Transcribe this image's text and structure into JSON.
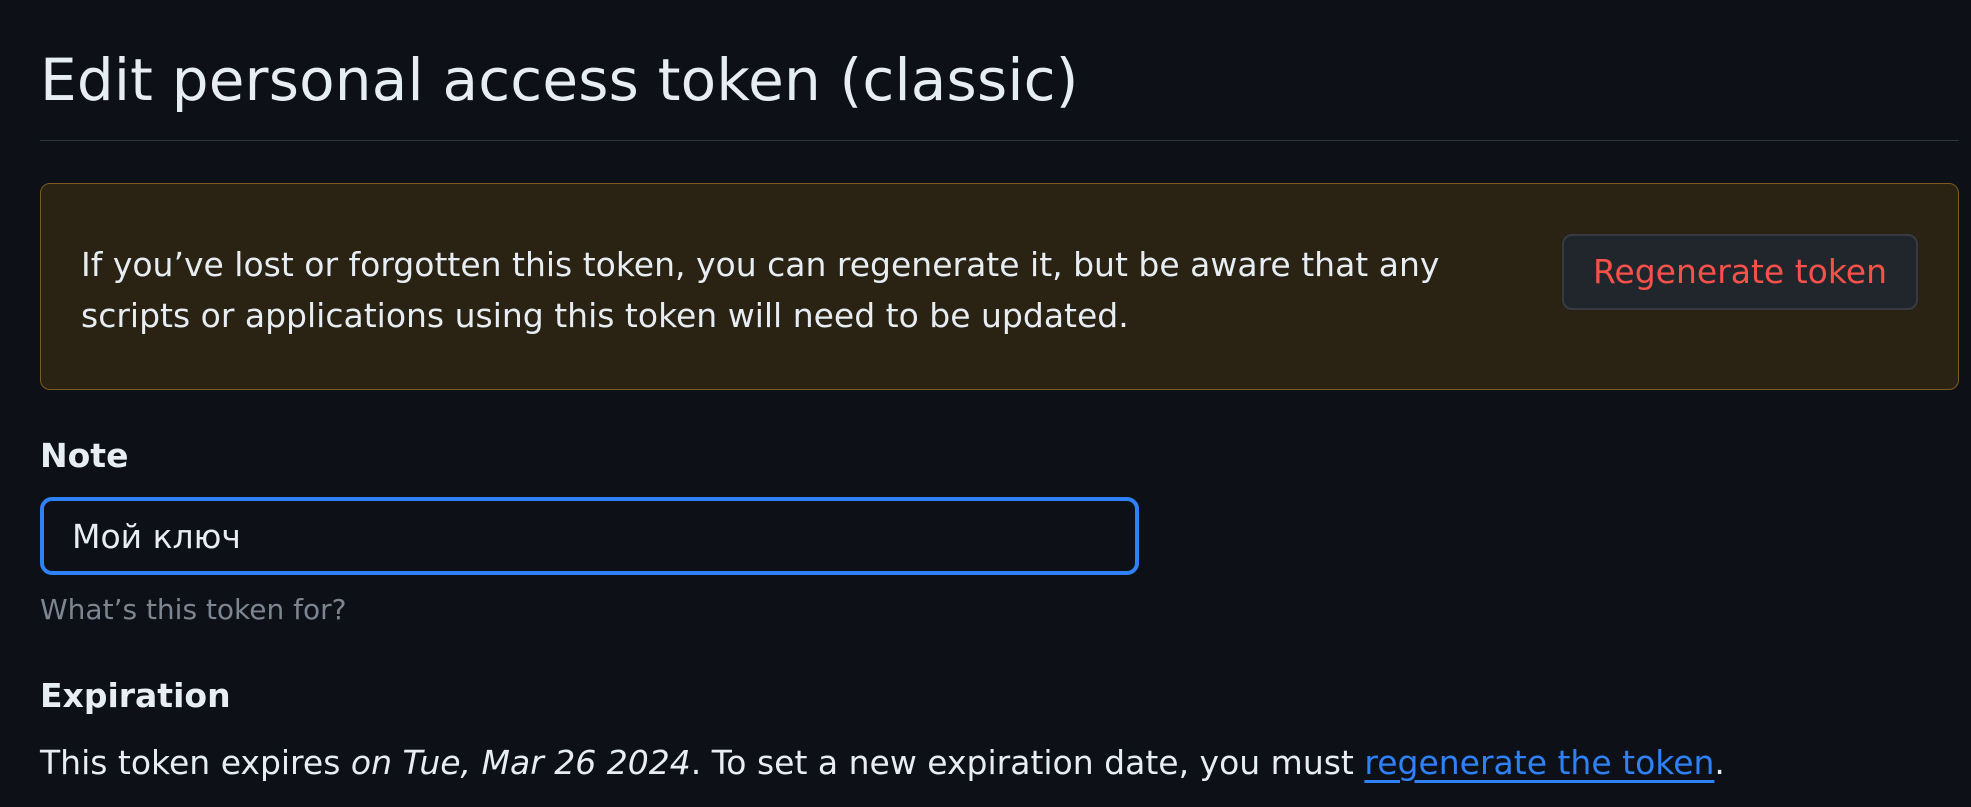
{
  "page": {
    "title": "Edit personal access token (classic)"
  },
  "warning": {
    "message": "If you’ve lost or forgotten this token, you can regenerate it, but be aware that any scripts or applications using this token will need to be updated.",
    "button_label": "Regenerate token"
  },
  "note": {
    "label": "Note",
    "value": "Мой ключ",
    "hint": "What’s this token for?"
  },
  "expiration": {
    "label": "Expiration",
    "prefix": "This token expires ",
    "date": "on Tue, Mar 26 2024",
    "middle": ". To set a new expiration date, you must ",
    "link_label": "regenerate the token",
    "suffix": "."
  },
  "colors": {
    "background": "#0d1117",
    "warning_background": "#2a2213",
    "warning_border": "#7d5a1e",
    "danger": "#f85149",
    "accent": "#2f81f7",
    "muted": "#7d8590"
  }
}
